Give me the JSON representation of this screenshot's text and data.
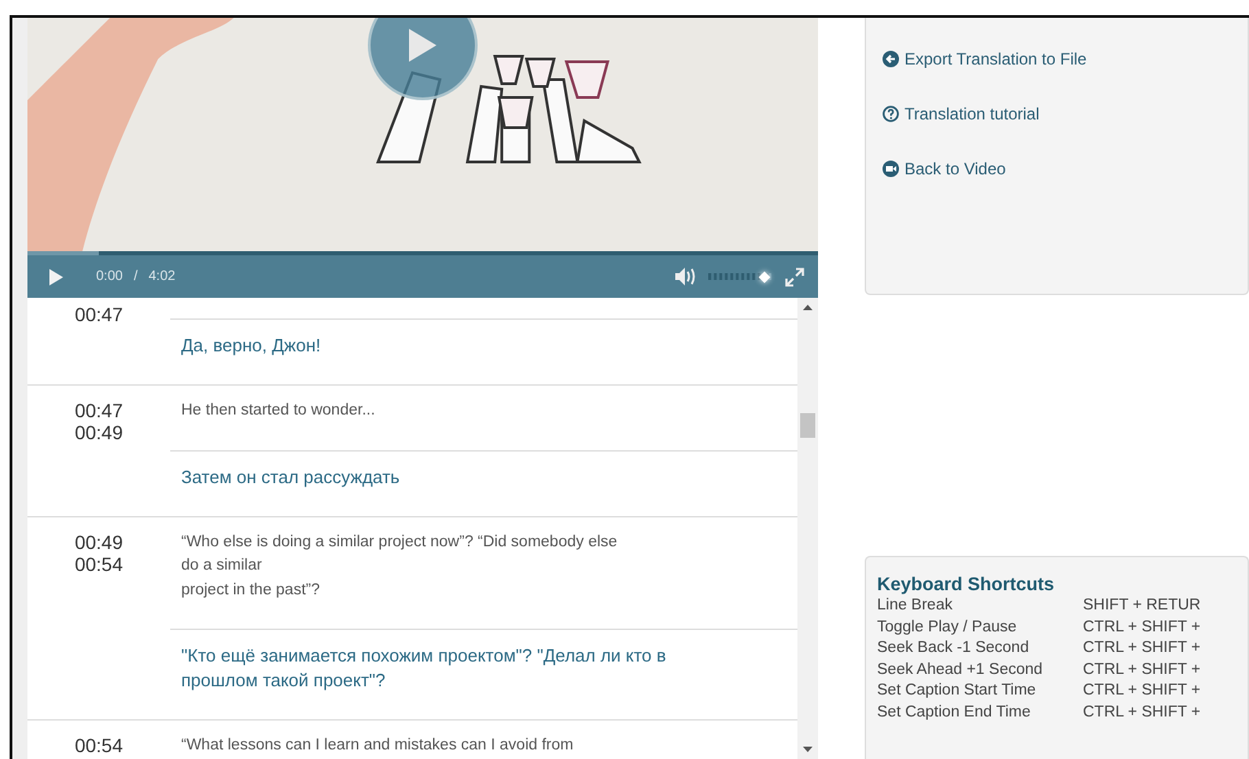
{
  "video": {
    "current_time": "0:00",
    "separator": "/",
    "duration": "4:02",
    "volume": {
      "level": 0.92
    }
  },
  "captions": [
    {
      "end": "00:47",
      "translation": "Да, верно, Джон!"
    },
    {
      "start": "00:47",
      "end": "00:49",
      "original": "He then started to wonder...",
      "translation": "Затем он стал рассуждать"
    },
    {
      "start": "00:49",
      "end": "00:54",
      "original": "“Who else is doing a similar project now”? “Did somebody else\ndo a similar\nproject in the past”?",
      "translation": "\"Кто ещё занимается похожим проектом\"? \"Делал ли кто в прошлом такой проект\"?"
    },
    {
      "start": "00:54",
      "original": "“What lessons can I learn and mistakes can I avoid from"
    }
  ],
  "actions": [
    {
      "label": "Export Translation to File",
      "kind": "export"
    },
    {
      "label": "Translation tutorial",
      "kind": "help"
    },
    {
      "label": "Back to Video",
      "kind": "video"
    }
  ],
  "shortcuts": {
    "title": "Keyboard Shortcuts",
    "items": [
      {
        "action": "Line Break",
        "keys": "SHIFT + RETUR"
      },
      {
        "action": "Toggle Play / Pause",
        "keys": "CTRL + SHIFT +"
      },
      {
        "action": "Seek Back -1 Second",
        "keys": "CTRL + SHIFT +"
      },
      {
        "action": "Seek Ahead +1 Second",
        "keys": "CTRL + SHIFT +"
      },
      {
        "action": "Set Caption Start Time",
        "keys": "CTRL + SHIFT +"
      },
      {
        "action": "Set Caption End Time",
        "keys": "CTRL + SHIFT +"
      }
    ]
  }
}
